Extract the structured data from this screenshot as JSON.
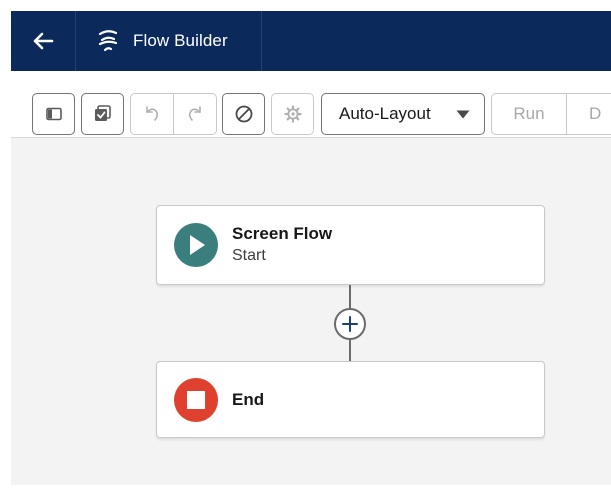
{
  "header": {
    "back_icon": "arrow-left-icon",
    "app_icon": "flow-icon",
    "title": "Flow Builder",
    "background_color": "#0b2a5b"
  },
  "toolbar": {
    "buttons": [
      {
        "name": "toggle-panel",
        "icon": "panel-left-icon"
      },
      {
        "name": "check-errors",
        "icon": "checkbox-stack-icon"
      },
      {
        "name": "undo",
        "icon": "undo-icon",
        "disabled": true
      },
      {
        "name": "redo",
        "icon": "redo-icon",
        "disabled": true
      },
      {
        "name": "cancel",
        "icon": "ban-icon"
      },
      {
        "name": "settings",
        "icon": "gear-icon",
        "disabled": true
      }
    ],
    "layout_select": {
      "value": "Auto-Layout",
      "icon": "caret-down-icon"
    },
    "run_label": "Run",
    "debug_label": "D"
  },
  "canvas": {
    "start_node": {
      "title": "Screen Flow",
      "subtitle": "Start",
      "icon": "play-icon",
      "color": "#3a7f7e"
    },
    "add_element_icon": "add-icon",
    "end_node": {
      "title": "End",
      "icon": "stop-icon",
      "color": "#e0402e"
    }
  }
}
